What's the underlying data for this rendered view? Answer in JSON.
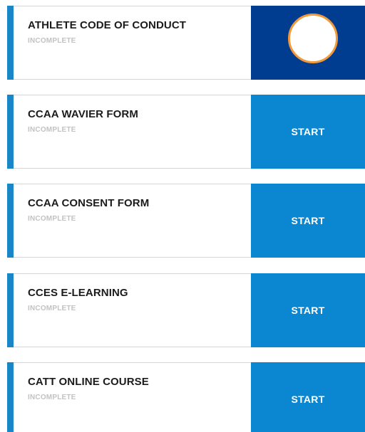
{
  "tasks": [
    {
      "title": "ATHLETE CODE OF CONDUCT",
      "status": "INCOMPLETE",
      "action": ""
    },
    {
      "title": "CCAA WAVIER FORM",
      "status": "INCOMPLETE",
      "action": "START"
    },
    {
      "title": "CCAA CONSENT FORM",
      "status": "INCOMPLETE",
      "action": "START"
    },
    {
      "title": "CCES E-LEARNING",
      "status": "INCOMPLETE",
      "action": "START"
    },
    {
      "title": "CATT ONLINE COURSE",
      "status": "INCOMPLETE",
      "action": "START"
    }
  ],
  "colors": {
    "accent": "#1a86c8",
    "action": "#0b86d0",
    "action_active": "#003c90",
    "highlight_ring": "#f29a3a"
  }
}
